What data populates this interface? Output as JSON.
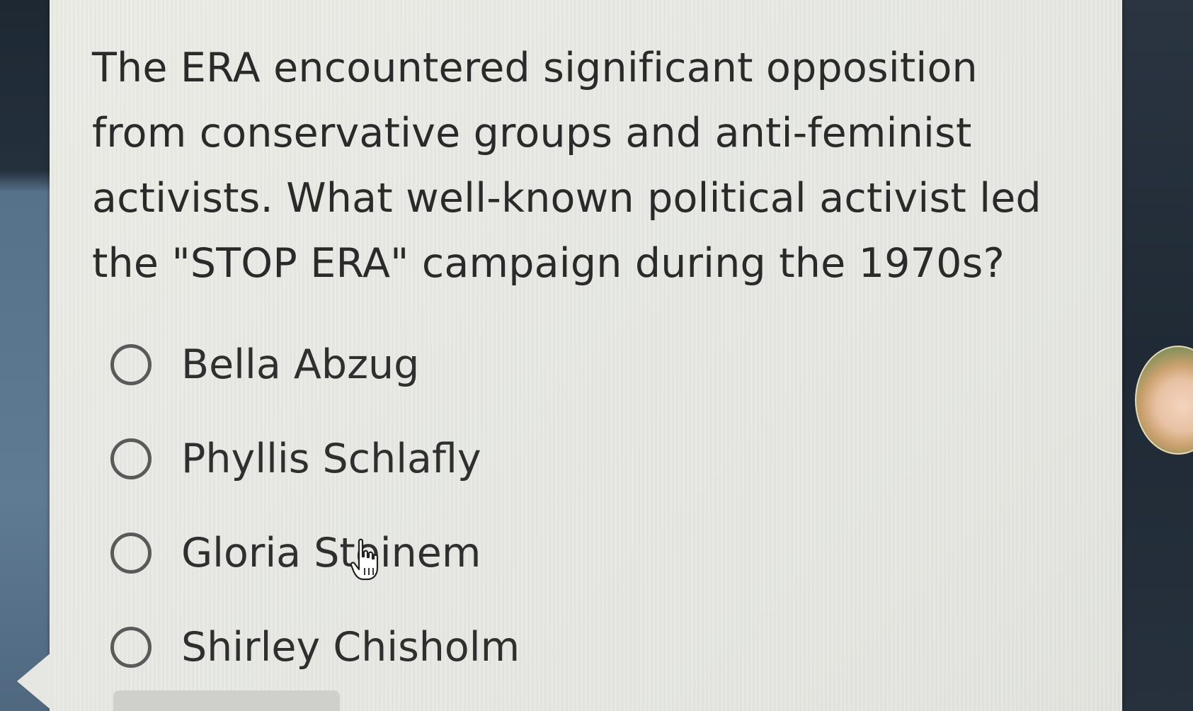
{
  "question": {
    "text": "The ERA encountered significant opposition from conservative groups and anti-feminist activists. What well-known political activist led the \"STOP ERA\" campaign during the 1970s?"
  },
  "options": [
    {
      "label": "Bella Abzug",
      "selected": false
    },
    {
      "label": "Phyllis Schlafly",
      "selected": false
    },
    {
      "label": "Gloria Steinem",
      "selected": false
    },
    {
      "label": "Shirley Chisholm",
      "selected": false
    }
  ],
  "icons": {
    "option_marker": "radio-button-icon",
    "cursor": "hand-pointer-icon",
    "participant": "avatar"
  },
  "colors": {
    "card_background": "#e8e9e4",
    "text": "#2a2a2a",
    "radio_border": "#5a5a5a",
    "frame": "#24303c"
  }
}
